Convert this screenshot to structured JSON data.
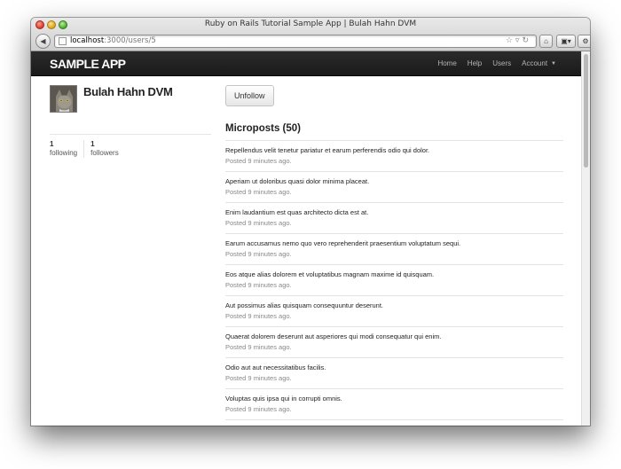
{
  "window": {
    "title": "Ruby on Rails Tutorial Sample App | Bulah Hahn DVM",
    "url_host": "localhost",
    "url_rest": ":3000/users/5"
  },
  "navbar": {
    "logo": "sample app",
    "items": [
      {
        "label": "Home"
      },
      {
        "label": "Help"
      },
      {
        "label": "Users"
      },
      {
        "label": "Account"
      }
    ]
  },
  "profile": {
    "name": "Bulah Hahn DVM",
    "following_count": "1",
    "following_label": "following",
    "followers_count": "1",
    "followers_label": "followers"
  },
  "main": {
    "unfollow_label": "Unfollow",
    "microposts_heading": "Microposts (50)",
    "posts": [
      {
        "content": "Repellendus velit tenetur pariatur et earum perferendis odio qui dolor.",
        "timestamp": "Posted 9 minutes ago."
      },
      {
        "content": "Aperiam ut doloribus quasi dolor minima placeat.",
        "timestamp": "Posted 9 minutes ago."
      },
      {
        "content": "Enim laudantium est quas architecto dicta est at.",
        "timestamp": "Posted 9 minutes ago."
      },
      {
        "content": "Earum accusamus nemo quo vero reprehenderit praesentium voluptatum sequi.",
        "timestamp": "Posted 9 minutes ago."
      },
      {
        "content": "Eos atque alias dolorem et voluptatibus magnam maxime id quisquam.",
        "timestamp": "Posted 9 minutes ago."
      },
      {
        "content": "Aut possimus alias quisquam consequuntur deserunt.",
        "timestamp": "Posted 9 minutes ago."
      },
      {
        "content": "Quaerat dolorem deserunt aut asperiores qui modi consequatur qui enim.",
        "timestamp": "Posted 9 minutes ago."
      },
      {
        "content": "Odio aut aut necessitatibus facilis.",
        "timestamp": "Posted 9 minutes ago."
      },
      {
        "content": "Voluptas quis ipsa qui in corrupti omnis.",
        "timestamp": "Posted 9 minutes ago."
      }
    ]
  }
}
